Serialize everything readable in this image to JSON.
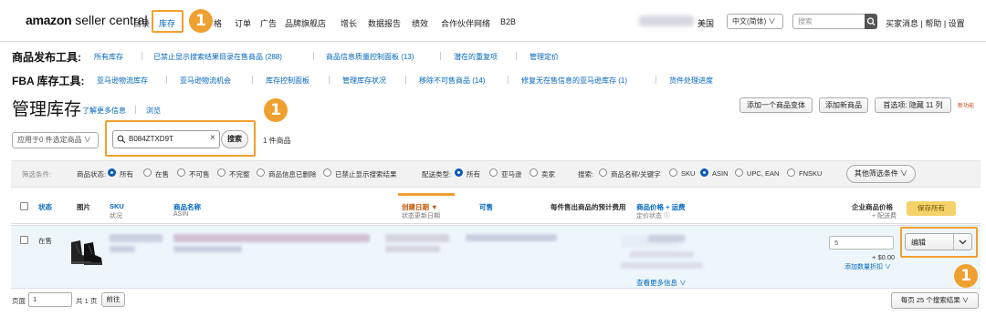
{
  "header": {
    "logo_bold": "amazon",
    "logo_rest": " seller central",
    "nav": [
      "目录",
      "库存",
      "格",
      "订单",
      "广告",
      "品牌旗舰店",
      "增长",
      "数据报告",
      "绩效",
      "合作伙伴网络",
      "B2B"
    ],
    "marketplace": "美国",
    "language": "中文(简体) ∨",
    "search_placeholder": "搜索",
    "links": "买家消息 | 帮助 | 设置"
  },
  "publish_tools": {
    "label": "商品发布工具:",
    "links": [
      "所有库存",
      "已禁止显示搜索结果目录在售商品 (288)",
      "商品信息质量控制面板 (13)",
      "潜在的重复项",
      "管理定价"
    ]
  },
  "fba_tools": {
    "label": "FBA 库存工具:",
    "links": [
      "亚马逊物流库存",
      "亚马逊物流机会",
      "库存控制面板",
      "管理库存状况",
      "移除不可售商品 (14)",
      "修复无在售信息的亚马逊库存 (1)",
      "货件处理进度"
    ]
  },
  "page": {
    "title": "管理库存",
    "learn_more": "了解更多信息",
    "tour": "浏览",
    "add_variation": "添加一个商品变体",
    "add_product": "添加新商品",
    "preferences": "首选项: 隐藏 11 列",
    "new_feature": "新功能"
  },
  "search": {
    "apply_selected": "应用于0 件选定商品  ∨",
    "query": "B084ZTXD9T",
    "search_button": "搜索",
    "result_count": "1 件商品"
  },
  "filters": {
    "label": "筛选条件:",
    "status_label": "商品状态:",
    "status_options": [
      "所有",
      "在售",
      "不可售",
      "不完整",
      "商品信息已删除",
      "已禁止显示搜索结果"
    ],
    "fulfillment_label": "配送类型:",
    "fulfillment_options": [
      "所有",
      "亚马逊",
      "卖家"
    ],
    "search_label": "搜索:",
    "search_options": [
      "商品名称/关键字",
      "SKU",
      "ASIN",
      "UPC, EAN",
      "FNSKU"
    ],
    "more_filters": "其他筛选条件 ∨"
  },
  "table": {
    "headers": {
      "status": "状态",
      "image": "图片",
      "sku": "SKU",
      "sku_sub": "状况",
      "name": "商品名称",
      "name_sub": "ASIN",
      "created": "创建日期 ▼",
      "created_sub": "状态更新日期",
      "available": "可售",
      "fee": "每件售出商品的预计费用",
      "price": "商品价格 + 运费",
      "price_sub": "定价状态 ⓘ",
      "business": "企业商品价格",
      "business_sub": "+ 配送费",
      "save_all": "保存所有"
    },
    "row": {
      "status": "在售",
      "price_input": "5",
      "shipping": "+ $0.00",
      "add_tier": "添加数量折扣  ∨",
      "action": "编辑",
      "more_details": "查看更多信息  ∨"
    }
  },
  "pagination": {
    "page_label": "页面",
    "page_value": "1",
    "total": "共 1 页",
    "go": "前往",
    "per_page": "每页 25 个搜索结果  ∨"
  },
  "markers": [
    "1",
    "1",
    "1"
  ],
  "colors": {
    "accent": "#f0a030",
    "link": "#0066c0",
    "radio": "#0a59b3",
    "save": "#f5d26a"
  }
}
